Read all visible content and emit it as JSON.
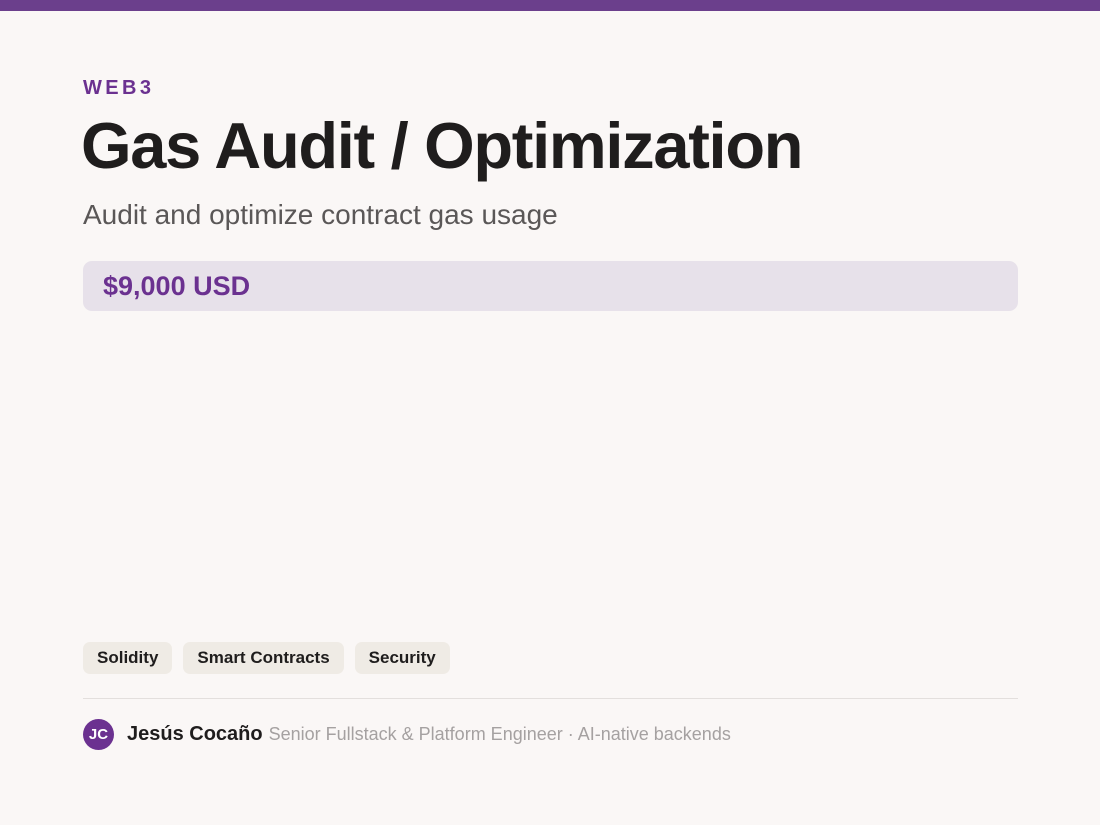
{
  "colors": {
    "accent": "#6b3190",
    "top_bar": "#6b3f8c",
    "background": "#faf7f6",
    "price_box": "#e7e1ea",
    "tag_bg": "#efebe5"
  },
  "header": {
    "category": "WEB3",
    "title": "Gas Audit / Optimization",
    "subtitle": "Audit and optimize contract gas usage"
  },
  "price": {
    "label": "$9,000 USD"
  },
  "tags": [
    "Solidity",
    "Smart Contracts",
    "Security"
  ],
  "author": {
    "initials": "JC",
    "name": "Jesús Cocaño",
    "role": "Senior Fullstack & Platform Engineer · AI-native backends"
  }
}
